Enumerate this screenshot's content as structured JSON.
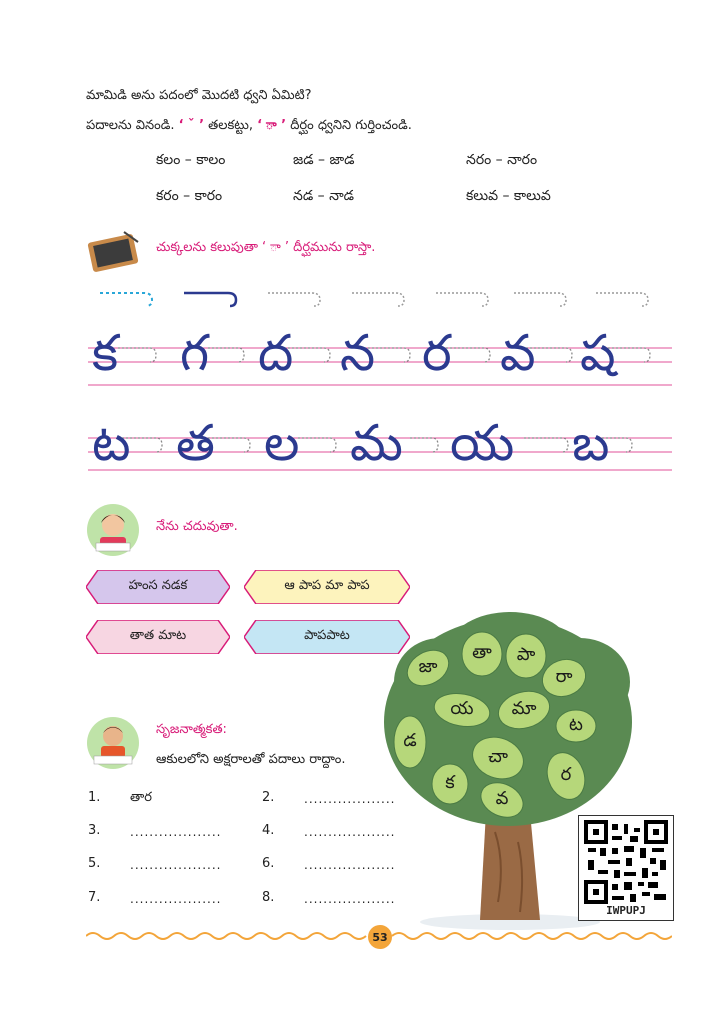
{
  "question": "మామిడి అను పదంలో మొదటి ధ్వని ఏమిటి?",
  "instruction": {
    "part1": "పదాలను వినండి.",
    "symbol1": "‘ ˇ ’",
    "part2": "తలకట్టు,",
    "symbol2": "‘ ా ’",
    "part3": "దీర్ఘం ధ్వనిని గుర్తించండి."
  },
  "word_pairs": [
    [
      "కలం – కాలం",
      "జడ – జాడ",
      "నరం – నారం"
    ],
    [
      "కరం – కారం",
      "నడ – నాడ",
      "కలువ – కాలువ"
    ]
  ],
  "tracing": {
    "title": "చుక్కలను కలుపుతా ‘ ా ’ దీర్ఘమును రాస్తా.",
    "row1_letters": [
      "క",
      "గ",
      "ద",
      "న",
      "ర",
      "వ",
      "ష"
    ],
    "row2_letters": [
      "ట",
      "త",
      "ల",
      "మ",
      "య",
      "బ"
    ]
  },
  "reading": {
    "title": "నేను చదువుతా.",
    "phrases": [
      "హంస నడక",
      "ఆ పాప మా పాప",
      "తాత మాట",
      "పాపపాట"
    ]
  },
  "creativity": {
    "title": "సృజనాత్మకత:",
    "instruction": "ఆకులలోని అక్షరాలతో పదాలు రాద్దాం.",
    "items": [
      {
        "num": "1.",
        "text": "తార"
      },
      {
        "num": "2.",
        "text": "..................."
      },
      {
        "num": "3.",
        "text": "..................."
      },
      {
        "num": "4.",
        "text": "..................."
      },
      {
        "num": "5.",
        "text": "..................."
      },
      {
        "num": "6.",
        "text": "..................."
      },
      {
        "num": "7.",
        "text": "..................."
      },
      {
        "num": "8.",
        "text": "..................."
      }
    ]
  },
  "tree_leaves": [
    "జా",
    "తా",
    "పా",
    "రా",
    "య",
    "మా",
    "ట",
    "డ",
    "చా",
    "క",
    "ర",
    "వ"
  ],
  "qr_code_label": "IWPUPJ",
  "page_number": "53",
  "colors": {
    "pink": "#d81b78",
    "label_purple": "#d5c6ec",
    "label_yellow": "#fdf3bd",
    "label_pink": "#f7d6e2",
    "label_blue": "#c4e6f4",
    "tree_dark": "#5a8a52",
    "leaf_light": "#b6d77a",
    "trunk": "#9a6a45",
    "border_orange": "#f3a53a"
  }
}
